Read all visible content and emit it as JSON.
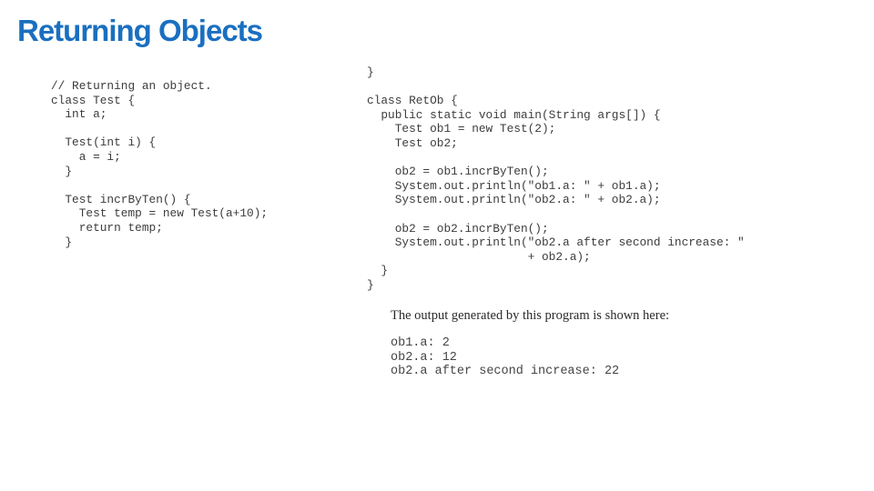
{
  "slide": {
    "title": "Returning Objects",
    "title_color": "#1a6fc0"
  },
  "code_left": {
    "lines": [
      "// Returning an object.",
      "class Test {",
      "  int a;",
      "",
      "  Test(int i) {",
      "    a = i;",
      "  }",
      "",
      "  Test incrByTen() {",
      "    Test temp = new Test(a+10);",
      "    return temp;",
      "  }"
    ]
  },
  "code_right": {
    "lines": [
      "}",
      "",
      "class RetOb {",
      "  public static void main(String args[]) {",
      "    Test ob1 = new Test(2);",
      "    Test ob2;",
      "",
      "    ob2 = ob1.incrByTen();",
      "    System.out.println(\"ob1.a: \" + ob1.a);",
      "    System.out.println(\"ob2.a: \" + ob2.a);",
      "",
      "    ob2 = ob2.incrByTen();",
      "    System.out.println(\"ob2.a after second increase: \"",
      "                       + ob2.a);",
      "  }",
      "}"
    ]
  },
  "output": {
    "caption": "The output generated by this program is shown here:",
    "lines": [
      "ob1.a: 2",
      "ob2.a: 12",
      "ob2.a after second increase: 22"
    ]
  }
}
